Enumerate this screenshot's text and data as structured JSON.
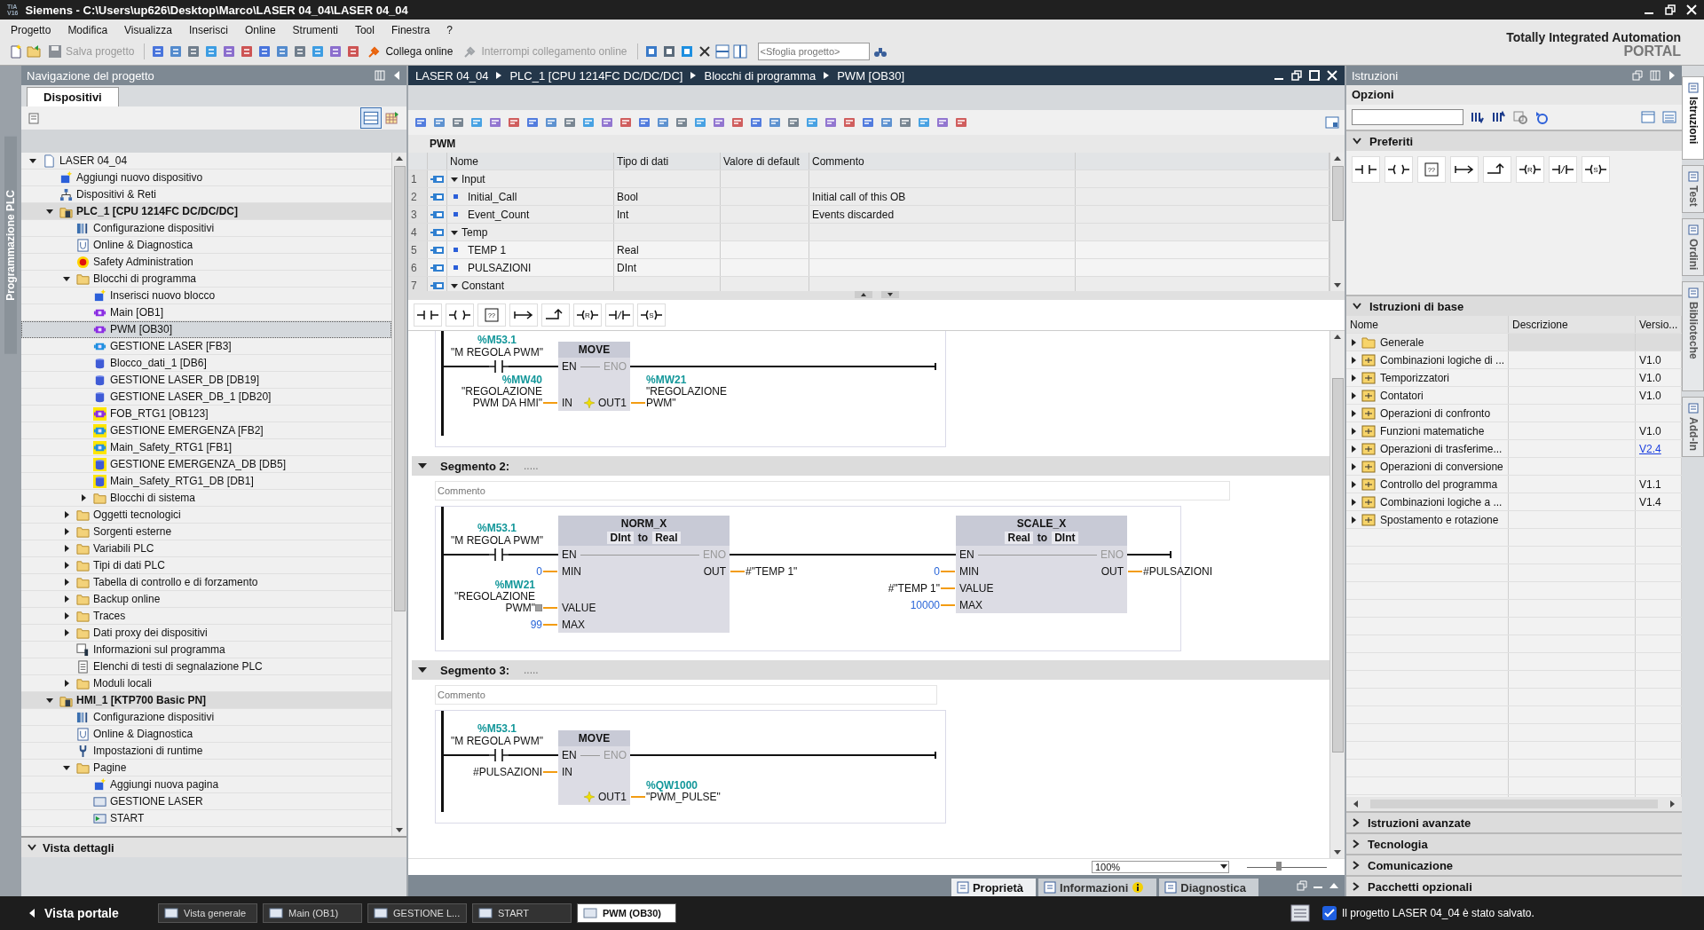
{
  "title_bar": {
    "logo": [
      "TIA",
      "V16"
    ],
    "title": "Siemens  -  C:\\Users\\up626\\Desktop\\Marco\\LASER 04_04\\LASER 04_04"
  },
  "menu": [
    "Progetto",
    "Modifica",
    "Visualizza",
    "Inserisci",
    "Online",
    "Strumenti",
    "Tool",
    "Finestra",
    "?"
  ],
  "toolbar": {
    "buttons": [
      {
        "label": "Salva progetto",
        "disabled": true
      },
      {
        "label": "Collega online",
        "disabled": false
      },
      {
        "label": "Interrompi collegamento online",
        "disabled": true
      }
    ],
    "search": {
      "placeholder": "<Sfoglia progetto>"
    }
  },
  "brand": {
    "line1": "Totally Integrated Automation",
    "line2": "PORTAL"
  },
  "side_strip": {
    "label": "Programmazione PLC"
  },
  "project_navigation": {
    "title": "Navigazione del progetto",
    "tabs": [
      {
        "label": "Dispositivi",
        "selected": true
      }
    ],
    "tree": [
      {
        "label": "LASER 04_04",
        "kind": "file",
        "expanded": true,
        "selected": false,
        "children": [
          {
            "label": "Aggiungi nuovo dispositivo",
            "kind": "add",
            "selected": false
          },
          {
            "label": "Dispositivi & Reti",
            "kind": "network",
            "selected": false
          },
          {
            "label": "PLC_1 [CPU 1214FC DC/DC/DC]",
            "kind": "device",
            "expanded": true,
            "selected": false,
            "children": [
              {
                "label": "Configurazione dispositivi",
                "kind": "config",
                "selected": false
              },
              {
                "label": "Online & Diagnostica",
                "kind": "diag",
                "selected": false
              },
              {
                "label": "Safety Administration",
                "kind": "safety",
                "selected": false
              },
              {
                "label": "Blocchi di programma",
                "kind": "folder",
                "expanded": true,
                "selected": false,
                "children": [
                  {
                    "label": "Inserisci nuovo blocco",
                    "kind": "add",
                    "selected": false
                  },
                  {
                    "label": "Main [OB1]",
                    "kind": "ob",
                    "selected": false
                  },
                  {
                    "label": "PWM [OB30]",
                    "kind": "ob",
                    "selected": true
                  },
                  {
                    "label": "GESTIONE LASER [FB3]",
                    "kind": "fb",
                    "selected": false
                  },
                  {
                    "label": "Blocco_dati_1 [DB6]",
                    "kind": "db",
                    "selected": false
                  },
                  {
                    "label": "GESTIONE LASER_DB [DB19]",
                    "kind": "db",
                    "selected": false
                  },
                  {
                    "label": "GESTIONE LASER_DB_1 [DB20]",
                    "kind": "db",
                    "selected": false
                  },
                  {
                    "label": "FOB_RTG1 [OB123]",
                    "kind": "obf",
                    "selected": false
                  },
                  {
                    "label": "GESTIONE EMERGENZA [FB2]",
                    "kind": "fbf",
                    "selected": false
                  },
                  {
                    "label": "Main_Safety_RTG1 [FB1]",
                    "kind": "fbf",
                    "selected": false
                  },
                  {
                    "label": "GESTIONE EMERGENZA_DB [DB5]",
                    "kind": "dbf",
                    "selected": false
                  },
                  {
                    "label": "Main_Safety_RTG1_DB [DB1]",
                    "kind": "dbf",
                    "selected": false
                  },
                  {
                    "label": "Blocchi di sistema",
                    "kind": "folder",
                    "expanded": false,
                    "selected": false
                  }
                ]
              },
              {
                "label": "Oggetti tecnologici",
                "kind": "folder",
                "expanded": false,
                "selected": false
              },
              {
                "label": "Sorgenti esterne",
                "kind": "folder",
                "expanded": false,
                "selected": false
              },
              {
                "label": "Variabili PLC",
                "kind": "folder",
                "expanded": false,
                "selected": false
              },
              {
                "label": "Tipi di dati PLC",
                "kind": "folder",
                "expanded": false,
                "selected": false
              },
              {
                "label": "Tabella di controllo e di forzamento",
                "kind": "folder",
                "expanded": false,
                "selected": false
              },
              {
                "label": "Backup online",
                "kind": "folder",
                "expanded": false,
                "selected": false
              },
              {
                "label": "Traces",
                "kind": "folder",
                "expanded": false,
                "selected": false
              },
              {
                "label": "Dati proxy dei dispositivi",
                "kind": "folder",
                "expanded": false,
                "selected": false
              },
              {
                "label": "Informazioni sul programma",
                "kind": "info",
                "selected": false
              },
              {
                "label": "Elenchi di testi di segnalazione PLC",
                "kind": "list",
                "selected": false
              },
              {
                "label": "Moduli locali",
                "kind": "folder",
                "expanded": false,
                "selected": false
              }
            ]
          },
          {
            "label": "HMI_1 [KTP700 Basic PN]",
            "kind": "device",
            "expanded": true,
            "selected": false,
            "children": [
              {
                "label": "Configurazione dispositivi",
                "kind": "config",
                "selected": false
              },
              {
                "label": "Online & Diagnostica",
                "kind": "diag",
                "selected": false
              },
              {
                "label": "Impostazioni di runtime",
                "kind": "runtime",
                "selected": false
              },
              {
                "label": "Pagine",
                "kind": "folder",
                "expanded": true,
                "selected": false,
                "children": [
                  {
                    "label": "Aggiungi nuova pagina",
                    "kind": "add",
                    "selected": false
                  },
                  {
                    "label": "GESTIONE LASER",
                    "kind": "screen",
                    "selected": false
                  },
                  {
                    "label": "START",
                    "kind": "screenstart",
                    "selected": false
                  }
                ]
              }
            ]
          }
        ]
      }
    ],
    "details": {
      "title": "Vista dettagli"
    }
  },
  "editor": {
    "breadcrumb": [
      "LASER 04_04",
      "PLC_1 [CPU 1214FC DC/DC/DC]",
      "Blocchi di programma",
      "PWM [OB30]"
    ],
    "block_name": "PWM",
    "interface": {
      "columns": [
        "Nome",
        "Tipo di dati",
        "Valore di default",
        "Commento"
      ],
      "rows": [
        {
          "num": "1",
          "kind": "section",
          "expanded": true,
          "name": "Input"
        },
        {
          "num": "2",
          "kind": "var",
          "name": "Initial_Call",
          "type": "Bool",
          "comment": "Initial call of this OB"
        },
        {
          "num": "3",
          "kind": "var",
          "name": "Event_Count",
          "type": "Int",
          "comment": "Events discarded"
        },
        {
          "num": "4",
          "kind": "section",
          "expanded": true,
          "name": "Temp"
        },
        {
          "num": "5",
          "kind": "var",
          "name": "TEMP 1",
          "type": "Real"
        },
        {
          "num": "6",
          "kind": "var",
          "name": "PULSAZIONI",
          "type": "DInt"
        },
        {
          "num": "7",
          "kind": "section",
          "expanded": true,
          "name": "Constant"
        }
      ]
    },
    "favorites": [
      {
        "kind": "contact"
      },
      {
        "kind": "coil"
      },
      {
        "kind": "box",
        "label": "??"
      },
      {
        "kind": "jump"
      },
      {
        "kind": "branch"
      },
      {
        "kind": "coil",
        "label": "R"
      },
      {
        "kind": "nc"
      },
      {
        "kind": "coil",
        "label": "S"
      }
    ],
    "networks": [
      {
        "contact": {
          "address": "%M53.1",
          "name": "\"M REGOLA PWM\""
        },
        "boxes": [
          {
            "name": "MOVE",
            "rows": [
              {
                "kind": "en",
                "pin_in": "EN",
                "pin_out": "ENO"
              },
              {
                "kind": "data",
                "pin_in": "IN",
                "in_operand": {
                  "address": "%MW40",
                  "name": "\"REGOLAZIONE PWM DA HMI\""
                },
                "pin_out": "OUT1",
                "insert_marker": true,
                "out_operand": {
                  "address": "%MW21",
                  "name": "\"REGOLAZIONE PWM\""
                }
              }
            ]
          }
        ]
      },
      {
        "title": "Segmento 2:",
        "dots": ".....",
        "comment_placeholder": "Commento",
        "contact": {
          "address": "%M53.1",
          "name": "\"M REGOLA PWM\""
        },
        "boxes": [
          {
            "name": "NORM_X",
            "types": [
              "DInt",
              "to",
              "Real"
            ],
            "rows": [
              {
                "kind": "en",
                "pin_in": "EN",
                "pin_out": "ENO"
              },
              {
                "kind": "data",
                "pin_in": "MIN",
                "in_operand": {
                  "kind": "const",
                  "name": "0"
                },
                "pin_out": "OUT",
                "out_operand": {
                  "name": "#\"TEMP 1\""
                }
              },
              {
                "kind": "data",
                "pin_in": "VALUE",
                "convert_marker": true,
                "in_operand": {
                  "address": "%MW21",
                  "name": "\"REGOLAZIONE PWM\""
                }
              },
              {
                "kind": "data",
                "pin_in": "MAX",
                "in_operand": {
                  "kind": "const",
                  "name": "99"
                }
              }
            ]
          },
          {
            "name": "SCALE_X",
            "types": [
              "Real",
              "to",
              "DInt"
            ],
            "rows": [
              {
                "kind": "en",
                "pin_in": "EN",
                "pin_out": "ENO"
              },
              {
                "kind": "data",
                "pin_in": "MIN",
                "in_operand": {
                  "kind": "const",
                  "name": "0"
                },
                "pin_out": "OUT",
                "out_operand": {
                  "name": "#PULSAZIONI"
                }
              },
              {
                "kind": "data",
                "pin_in": "VALUE",
                "in_operand": {
                  "name": "#\"TEMP 1\""
                }
              },
              {
                "kind": "data",
                "pin_in": "MAX",
                "in_operand": {
                  "kind": "const",
                  "name": "10000"
                }
              }
            ]
          }
        ]
      },
      {
        "title": "Segmento 3:",
        "dots": ".....",
        "comment_placeholder": "Commento",
        "contact": {
          "address": "%M53.1",
          "name": "\"M REGOLA PWM\""
        },
        "boxes": [
          {
            "name": "MOVE",
            "rows": [
              {
                "kind": "en",
                "pin_in": "EN",
                "pin_out": "ENO"
              },
              {
                "kind": "data",
                "pin_in": "IN",
                "in_operand": {
                  "name": "#PULSAZIONI"
                }
              },
              {
                "kind": "data",
                "pin_out": "OUT1",
                "insert_marker": true,
                "out_operand": {
                  "address": "%QW1000",
                  "name": "\"PWM_PULSE\""
                }
              }
            ]
          }
        ]
      }
    ],
    "zoom": {
      "value": "100%",
      "level": 0.4
    }
  },
  "inspector_tabs": [
    {
      "label": "Proprietà",
      "selected": true
    },
    {
      "label": "Informazioni",
      "selected": false,
      "info": true
    },
    {
      "label": "Diagnostica",
      "selected": false
    }
  ],
  "instructions": {
    "title": "Istruzioni",
    "options": {
      "title": "Opzioni"
    },
    "favorites": {
      "title": "Preferiti",
      "items": [
        {
          "kind": "contact"
        },
        {
          "kind": "coil"
        },
        {
          "kind": "box",
          "label": "??"
        },
        {
          "kind": "jump"
        },
        {
          "kind": "branch"
        },
        {
          "kind": "coil",
          "label": "R"
        },
        {
          "kind": "nc"
        },
        {
          "kind": "coil",
          "label": "S"
        }
      ]
    },
    "basic": {
      "title": "Istruzioni di base",
      "columns": [
        "Nome",
        "Descrizione",
        "Versio..."
      ],
      "rows": [
        {
          "name": "Generale",
          "kind": "folder",
          "selected": true
        },
        {
          "name": "Combinazioni logiche di ...",
          "version": "V1.0",
          "selected": false
        },
        {
          "name": "Temporizzatori",
          "version": "V1.0",
          "selected": false
        },
        {
          "name": "Contatori",
          "version": "V1.0",
          "selected": false
        },
        {
          "name": "Operazioni di confronto",
          "selected": false
        },
        {
          "name": "Funzioni matematiche",
          "version": "V1.0",
          "selected": false
        },
        {
          "name": "Operazioni di trasferime...",
          "version": "V2.4",
          "link": true,
          "selected": false
        },
        {
          "name": "Operazioni di conversione",
          "selected": false
        },
        {
          "name": "Controllo del programma",
          "version": "V1.1",
          "selected": false
        },
        {
          "name": "Combinazioni logiche a ...",
          "version": "V1.4",
          "selected": false
        },
        {
          "name": "Spostamento e rotazione",
          "selected": false
        }
      ]
    },
    "sections": [
      "Istruzioni avanzate",
      "Tecnologia",
      "Comunicazione",
      "Pacchetti opzionali"
    ]
  },
  "side_tabs": [
    {
      "label": "Istruzioni",
      "selected": true
    },
    {
      "label": "Test",
      "selected": false
    },
    {
      "label": "Ordini",
      "selected": false
    },
    {
      "label": "Biblioteche",
      "selected": false
    },
    {
      "label": "Add-In",
      "selected": false
    }
  ],
  "taskbar": {
    "portal": "Vista portale",
    "tabs": [
      {
        "label": "Vista generale",
        "selected": false
      },
      {
        "label": "Main (OB1)",
        "selected": false
      },
      {
        "label": "GESTIONE L...",
        "selected": false
      },
      {
        "label": "START",
        "selected": false
      },
      {
        "label": "PWM (OB30)",
        "selected": true
      }
    ],
    "status": "Il progetto LASER 04_04 è stato salvato."
  }
}
